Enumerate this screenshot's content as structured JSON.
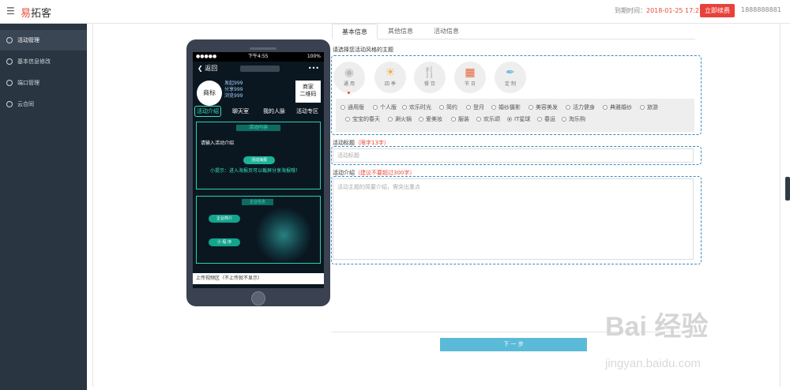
{
  "header": {
    "menu_icon": "hamburger-icon",
    "brand_accent": "易",
    "brand_rest": "拓客",
    "expire_label": "到期时间：",
    "expire_time": "2018-01-25 17:22:56",
    "renew_label": "立即续费",
    "user_id": "1888888881"
  },
  "sidebar": {
    "items": [
      {
        "label": "活动管理",
        "active": true
      },
      {
        "label": "基本信息修改",
        "active": false
      },
      {
        "label": "端口管理",
        "active": false
      },
      {
        "label": "云合同",
        "active": false
      }
    ]
  },
  "phone": {
    "status_left": "●●●●●",
    "status_time": "下午4:55",
    "status_right": "100%",
    "back_label": "返回",
    "more_label": "•••",
    "logo_label": "商标",
    "stats": [
      "发起999",
      "分享999",
      "浏览999"
    ],
    "qr_label_1": "商家",
    "qr_label_2": "二维码",
    "tabs": [
      "活动介绍",
      "聊天室",
      "我的人脉",
      "活动专区"
    ],
    "content_title": "活动内容",
    "content_intro": "请输入活动介绍",
    "poster_button": "活动海报",
    "tip": "小提示：进入海报页可以截屏分享海报哦！",
    "corp_title": "企业信息",
    "corp_pill_1": "企业简介",
    "corp_pill_2": "小 程 序",
    "upload_label": "上传视频区（不上传就不显示）"
  },
  "form": {
    "tabs": [
      "基本信息",
      "其他信息",
      "活动信息"
    ],
    "theme_label": "请选择您活动风格的主题",
    "themes": [
      {
        "name": "通 用",
        "icon": "grid-icon"
      },
      {
        "name": "四 季",
        "icon": "sun-icon"
      },
      {
        "name": "餐 饮",
        "icon": "food-icon"
      },
      {
        "name": "节 日",
        "icon": "calendar-icon"
      },
      {
        "name": "定 制",
        "icon": "pen-icon"
      }
    ],
    "styles_row1": [
      "通用版",
      "个人版",
      "欢乐时光",
      "简约",
      "登月",
      "婚纱摄影",
      "美容美发",
      "活力健身",
      "典雅婚纱",
      "旅游"
    ],
    "styles_row2": [
      "宝宝的春天",
      "涮火锅",
      "爱美妆",
      "服装",
      "欢乐颂",
      "IT星球",
      "春运",
      "淘乐购"
    ],
    "selected_style": "IT星球",
    "title_label": "活动标题",
    "title_hint": "（限字13字）",
    "title_placeholder": "活动标题",
    "intro_label": "活动介绍",
    "intro_hint": "（建议不要超过300字）",
    "intro_placeholder": "活动主题的简要介绍，需突出重点",
    "next_label": "下 一 步"
  },
  "watermark": {
    "text": "Bai 经验",
    "url": "jingyan.baidu.com"
  }
}
